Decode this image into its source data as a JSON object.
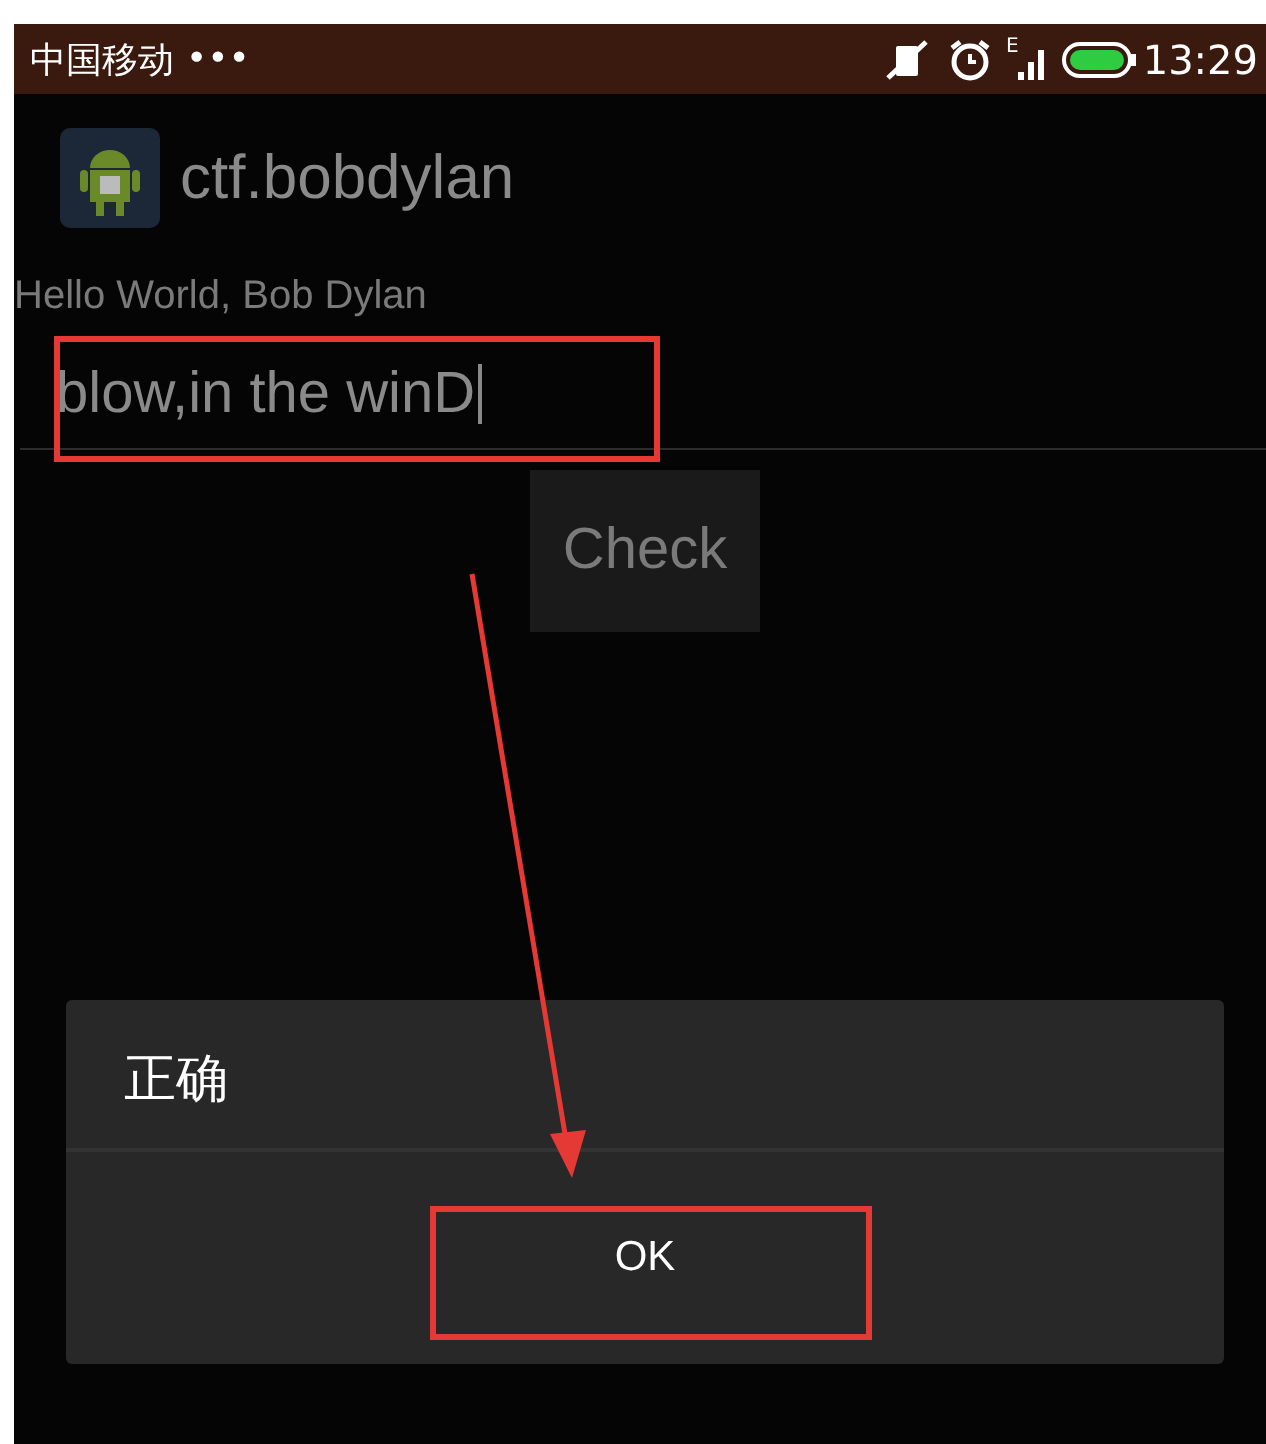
{
  "status_bar": {
    "carrier": "中国移动",
    "dots": "•••",
    "network": "E",
    "time": "13:29"
  },
  "app_bar": {
    "title": "ctf.bobdylan"
  },
  "greeting": "Hello World, Bob Dylan",
  "input": {
    "value": "blow,in the winD",
    "highlighted": true
  },
  "check_button": {
    "label": "Check"
  },
  "dialog": {
    "title": "正确",
    "buttons": [
      {
        "label": "OK",
        "highlighted": true
      }
    ]
  },
  "annotations": {
    "arrow": true
  }
}
